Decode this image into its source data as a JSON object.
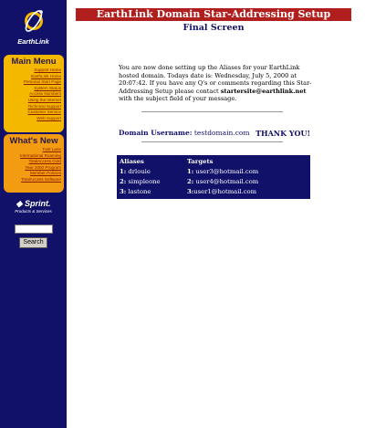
{
  "sidebar": {
    "logo_text": "EarthLink",
    "main_menu": {
      "heading": "Main Menu",
      "items": [
        "Support Home",
        "EarthLink Home",
        "Personal Start Page",
        "System Status",
        "Access Numbers",
        "Using the Internet",
        "Technical Support",
        "Customer Service",
        "Web Support"
      ]
    },
    "whats_new": {
      "heading": "What's New",
      "items": [
        "Fast Lane",
        "International Roaming",
        "TotalAccess Gold",
        "Year 2000 Program",
        "Member Policies",
        "TotalAccess Software"
      ]
    },
    "sprint": {
      "name": "Sprint.",
      "tagline": "Products & Services"
    },
    "search": {
      "button_label": "Search",
      "value": ""
    }
  },
  "header": {
    "banner": "EarthLink Domain Star-Addressing Setup",
    "subtitle": "Final Screen"
  },
  "message": {
    "intro": "You are now done setting up the Aliases for your EarthLink hosted domain. Todays date is: Wednesday, July 5, 2000 at 20:07:42. If you have any Q's or comments regarding this Star-Addressing Setup please contact ",
    "contact_email": "startersite@earthlink.net",
    "outro": " with the subject field of your message."
  },
  "domain": {
    "label": "Domain Username:",
    "value": "testdomain.com",
    "thanks": "THANK YOU!"
  },
  "table": {
    "headers": {
      "aliases": "Aliases",
      "targets": "Targets"
    },
    "rows": [
      {
        "num": "1:",
        "alias": "drlouie",
        "tnum": "1:",
        "target": "user3@hotmail.com"
      },
      {
        "num": "2:",
        "alias": "simpleone",
        "tnum": "2:",
        "target": "user4@hotmail.com"
      },
      {
        "num": "3:",
        "alias": "lastone",
        "tnum": "3:",
        "target": "user1@hotmail.com"
      }
    ]
  },
  "colors": {
    "sidebar": "#11116a",
    "menu_box": "#f5b800",
    "whats_new_box": "#f39c12",
    "banner": "#b01e1e"
  }
}
